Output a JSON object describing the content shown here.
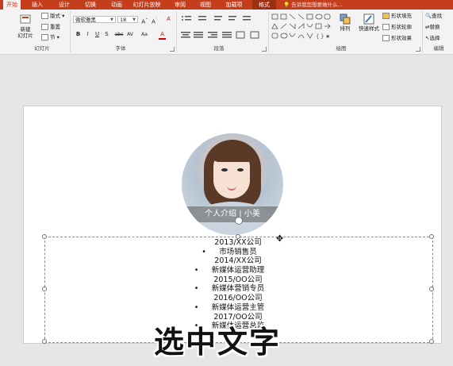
{
  "tabs": [
    "开始",
    "插入",
    "设计",
    "切换",
    "动画",
    "幻灯片放映",
    "审阅",
    "视图",
    "加载项",
    "格式"
  ],
  "tell_me": "告诉我您想要做什么...",
  "ribbon": {
    "slides": {
      "new_slide": "新建\n幻灯片",
      "layout": "版式",
      "reset": "重置",
      "section": "节",
      "label": "幻灯片"
    },
    "font": {
      "family": "微软雅黑",
      "size": "18",
      "label": "字体"
    },
    "paragraph": {
      "label": "段落"
    },
    "drawing": {
      "arrange": "排列",
      "quick_styles": "快速样式",
      "shape_fill": "形状填充",
      "shape_outline": "形状轮廓",
      "shape_effects": "形状效果",
      "label": "绘图"
    },
    "editing": {
      "find": "查找",
      "replace": "替换",
      "select": "选择",
      "label": "编辑"
    }
  },
  "slide": {
    "caption": "个人介绍 | 小美",
    "lines": [
      {
        "text": "2013/XX公司",
        "bullet": false
      },
      {
        "text": "市场销售员",
        "bullet": true
      },
      {
        "text": "2014/XX公司",
        "bullet": false
      },
      {
        "text": "新媒体运营助理",
        "bullet": true
      },
      {
        "text": "2015/OO公司",
        "bullet": false
      },
      {
        "text": "新媒体营销专员",
        "bullet": true
      },
      {
        "text": "2016/OO公司",
        "bullet": false
      },
      {
        "text": "新媒体运营主管",
        "bullet": true
      },
      {
        "text": "2017/OO公司",
        "bullet": false
      },
      {
        "text": "新媒体运营总监",
        "bullet": true
      }
    ]
  },
  "overlay_text": "选中文字",
  "colors": {
    "tab_bar": "#c43e1c",
    "ribbon": "#f3f3f3"
  }
}
